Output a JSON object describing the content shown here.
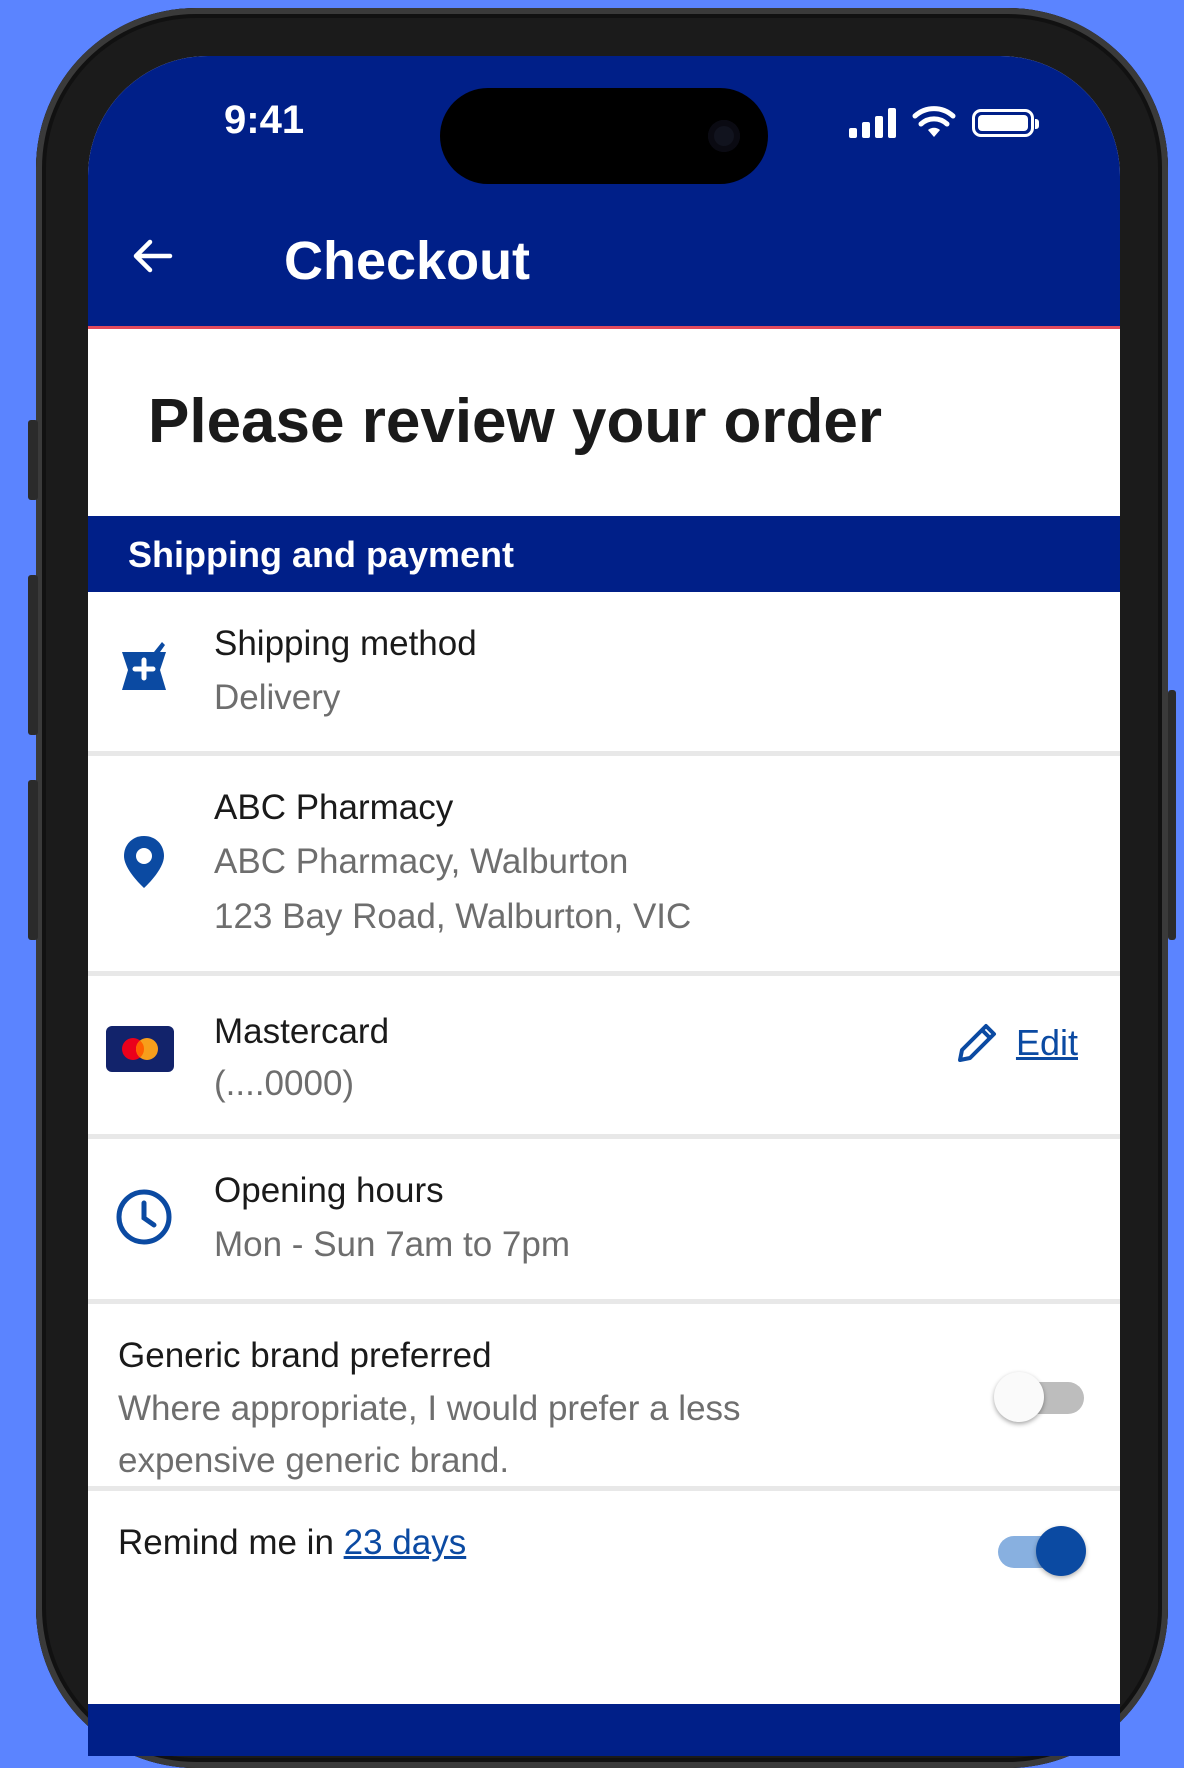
{
  "status_bar": {
    "time": "9:41"
  },
  "app_bar": {
    "title": "Checkout"
  },
  "page": {
    "heading": "Please review your order"
  },
  "section": {
    "title": "Shipping and payment"
  },
  "shipping": {
    "title": "Shipping method",
    "value": "Delivery",
    "icon": "pharmacy-icon"
  },
  "pharmacy": {
    "title": "ABC Pharmacy",
    "line1": "ABC Pharmacy, Walburton",
    "line2": "123 Bay Road, Walburton, VIC",
    "icon": "location-pin-icon"
  },
  "payment": {
    "title": "Mastercard",
    "value": "(....0000)",
    "edit_label": "Edit",
    "icon": "mastercard-icon"
  },
  "hours": {
    "title": "Opening hours",
    "value": "Mon - Sun 7am to 7pm",
    "icon": "clock-icon"
  },
  "generic": {
    "title": "Generic brand preferred",
    "line1": "Where appropriate, I would prefer a less",
    "line2": "expensive generic brand.",
    "enabled": false
  },
  "remind": {
    "prefix": "Remind me in ",
    "link": "23 days",
    "enabled": true
  },
  "colors": {
    "brand_navy": "#001f88",
    "accent_blue": "#0b4aa2",
    "background": "#5b84ff",
    "divider_red": "#e24a5c"
  }
}
